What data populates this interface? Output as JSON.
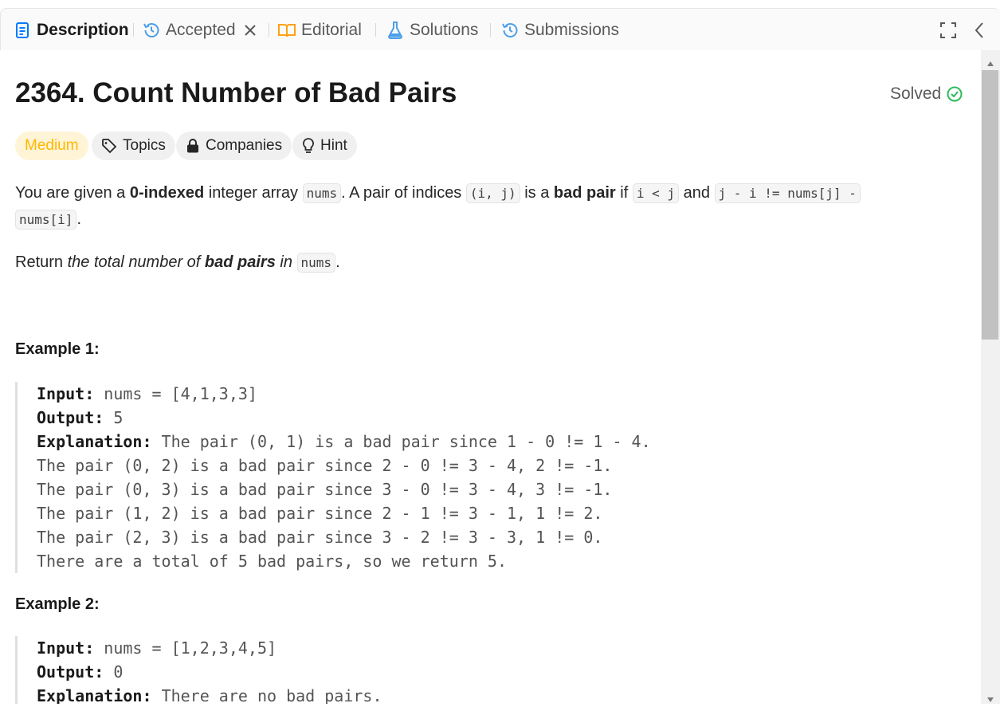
{
  "tabs": {
    "description": "Description",
    "accepted": "Accepted",
    "editorial": "Editorial",
    "solutions": "Solutions",
    "submissions": "Submissions"
  },
  "problem": {
    "title": "2364. Count Number of Bad Pairs",
    "status": "Solved",
    "difficulty": "Medium",
    "tags": {
      "topics": "Topics",
      "companies": "Companies",
      "hint": "Hint"
    },
    "statement": {
      "p1_a": "You are given a ",
      "p1_b": "0-indexed",
      "p1_c": " integer array ",
      "p1_code1": "nums",
      "p1_d": ". A pair of indices ",
      "p1_code2": "(i, j)",
      "p1_e": " is a ",
      "p1_f": "bad pair",
      "p1_g": " if ",
      "p1_code3": "i < j",
      "p1_h": " and ",
      "p1_code4": "j - i != nums[j] -",
      "p1_code5": "nums[i]",
      "p1_i": ".",
      "p2_a": "Return ",
      "p2_b": "the total number of ",
      "p2_c": "bad pairs",
      "p2_d": " in ",
      "p2_code": "nums",
      "p2_e": "."
    },
    "examples": [
      {
        "heading": "Example 1:",
        "input_label": "Input:",
        "input": " nums = [4,1,3,3]",
        "output_label": "Output:",
        "output": " 5",
        "explanation_label": "Explanation:",
        "explanation": " The pair (0, 1) is a bad pair since 1 - 0 != 1 - 4.",
        "lines": [
          "The pair (0, 2) is a bad pair since 2 - 0 != 3 - 4, 2 != -1.",
          "The pair (0, 3) is a bad pair since 3 - 0 != 3 - 4, 3 != -1.",
          "The pair (1, 2) is a bad pair since 2 - 1 != 3 - 1, 1 != 2.",
          "The pair (2, 3) is a bad pair since 3 - 2 != 3 - 3, 1 != 0.",
          "There are a total of 5 bad pairs, so we return 5."
        ]
      },
      {
        "heading": "Example 2:",
        "input_label": "Input:",
        "input": " nums = [1,2,3,4,5]",
        "output_label": "Output:",
        "output": " 0",
        "explanation_label": "Explanation:",
        "explanation": " There are no bad pairs."
      }
    ]
  },
  "colors": {
    "accent": "#007aff",
    "success": "#2cbb5d",
    "medium": "#ffb800",
    "editorial": "#ffa116"
  }
}
